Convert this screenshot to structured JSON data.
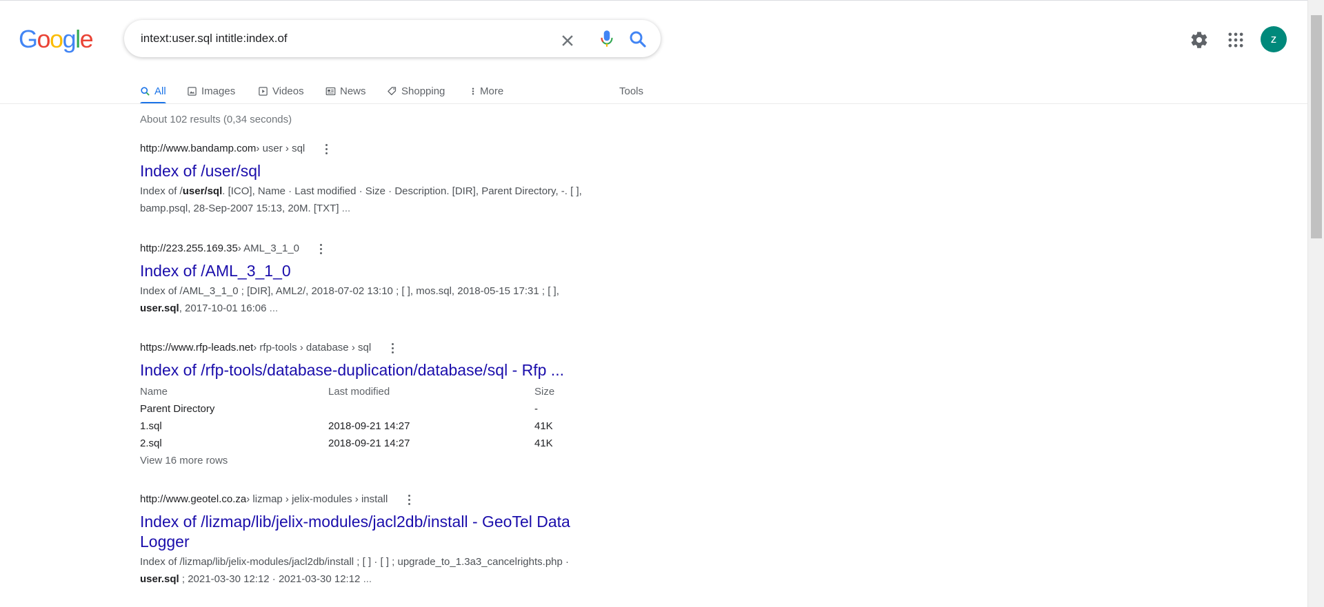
{
  "logo": {
    "letters": [
      "G",
      "o",
      "o",
      "g",
      "l",
      "e"
    ],
    "colors": [
      "#4285F4",
      "#EA4335",
      "#FBBC05",
      "#4285F4",
      "#34A853",
      "#EA4335"
    ]
  },
  "search": {
    "query": "intext:user.sql intitle:index.of"
  },
  "header": {
    "avatar_letter": "z",
    "avatar_color": "#00897b"
  },
  "tabs": [
    {
      "label": "All",
      "icon": "search-icon",
      "active": true
    },
    {
      "label": "Images",
      "icon": "image-icon"
    },
    {
      "label": "Videos",
      "icon": "play-icon"
    },
    {
      "label": "News",
      "icon": "news-icon"
    },
    {
      "label": "Shopping",
      "icon": "tag-icon"
    },
    {
      "label": "More",
      "icon": "more-vert-icon"
    },
    {
      "label": "Tools"
    }
  ],
  "stats": "About 102 results (0,34 seconds)",
  "results": [
    {
      "site": "http://www.bandamp.com",
      "crumbs": " › user › sql",
      "title": "Index of /user/sql",
      "snippet_line1_pre": "Index of /",
      "snippet_line1_bold": "user/sql",
      "snippet_line1_post": ". [ICO], Name · Last modified · Size · Description. [DIR], Parent Directory, -. [ ],",
      "snippet_line2": "bamp.psql, 28-Sep-2007 15:13, 20M. [TXT]",
      "ellipsis": " ..."
    },
    {
      "site": "http://223.255.169.35",
      "crumbs": " › AML_3_1_0",
      "title": "Index of /AML_3_1_0",
      "snippet_line1": "Index of /AML_3_1_0 ; [DIR], AML2/, 2018-07-02 13:10 ; [ ], mos.sql, 2018-05-15 17:31 ; [ ],",
      "snippet_line2_bold": "user.sql",
      "snippet_line2_post": ", 2017-10-01 16:06",
      "ellipsis": " ..."
    },
    {
      "site": "https://www.rfp-leads.net",
      "crumbs": " › rfp-tools › database › sql",
      "title": "Index of /rfp-tools/database-duplication/database/sql - Rfp ...",
      "table_header": [
        "Name",
        "Last modified",
        "Size"
      ],
      "rows": [
        [
          "Parent Directory",
          "",
          "-"
        ],
        [
          "1.sql",
          "2018-09-21 14:27",
          "41K"
        ],
        [
          "2.sql",
          "2018-09-21 14:27",
          "41K"
        ]
      ],
      "view_more": "View 16 more rows"
    },
    {
      "site": "http://www.geotel.co.za",
      "crumbs": " › lizmap › jelix-modules › install",
      "title_line1": "Index of /lizmap/lib/jelix-modules/jacl2db/install - GeoTel Data",
      "title_line2": "Logger",
      "snippet_line1": "Index of /lizmap/lib/jelix-modules/jacl2db/install ; [ ] · [ ] ; upgrade_to_1.3a3_cancelrights.php ·",
      "snippet_line2_bold": "user.sql",
      "snippet_line2_post": " ; 2021-03-30 12:12 · 2021-03-30 12:12",
      "ellipsis": " ..."
    }
  ]
}
